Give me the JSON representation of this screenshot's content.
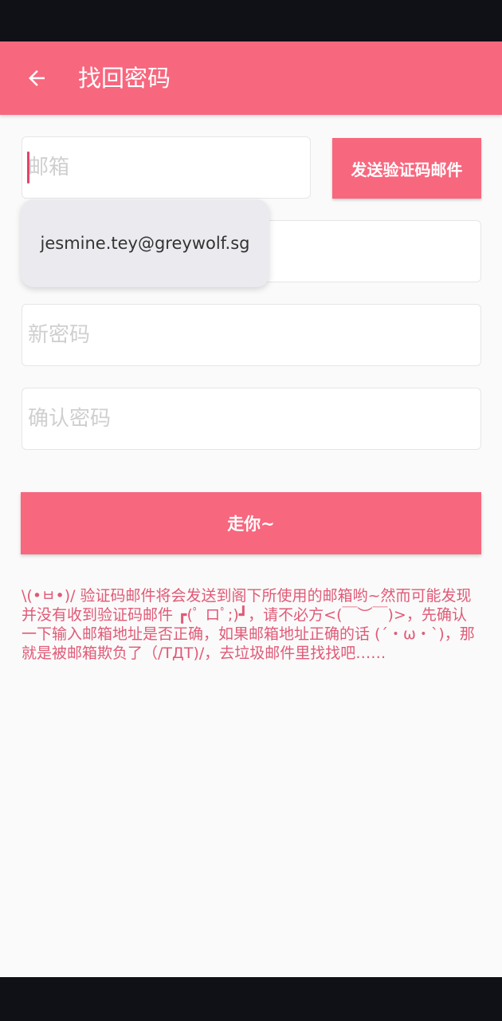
{
  "header": {
    "title": "找回密码",
    "back_icon": "arrow-left-icon"
  },
  "form": {
    "email_placeholder": "邮箱",
    "send_code_label": "发送验证码邮件",
    "new_password_placeholder": "新密码",
    "confirm_password_placeholder": "确认密码",
    "submit_label": "走你~"
  },
  "autofill": {
    "suggestion": "jesmine.tey@greywolf.sg"
  },
  "hint": {
    "text": "\\(•ㅂ•)/ 验证码邮件将会发送到阁下所使用的邮箱哟~然而可能发现并没有收到验证码邮件 ┏(ﾟ ロﾟ;)┛，请不必方<(￣︶￣)>，先确认一下输入邮箱地址是否正确，如果邮箱地址正确的话 (´・ω・`)，那就是被邮箱欺负了（/TДT)/，去垃圾邮件里找找吧……"
  },
  "colors": {
    "accent": "#f7677e",
    "hint_text": "#e05a76",
    "status_bar": "#101116",
    "background": "#fafafa"
  }
}
